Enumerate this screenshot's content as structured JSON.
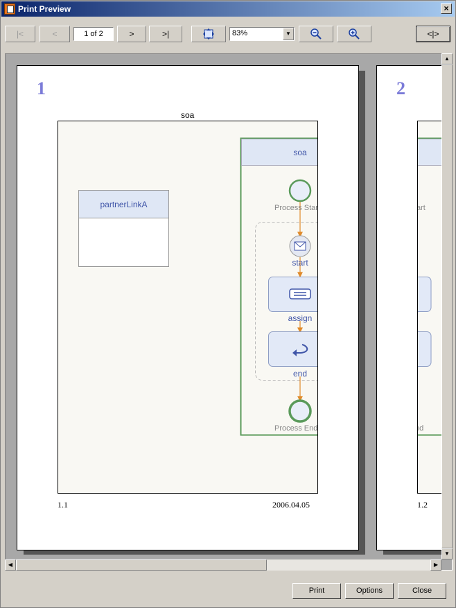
{
  "window": {
    "title": "Print Preview",
    "close_glyph": "×"
  },
  "toolbar": {
    "first_label": "|<",
    "prev_label": "<",
    "page_field": "1 of 2",
    "next_label": ">",
    "last_label": ">|",
    "zoom_value": "83%",
    "layout_label": "<|>"
  },
  "pages": [
    {
      "number": "1",
      "header": "soa",
      "footer_left": "1.1",
      "footer_right": "2006.04.05"
    },
    {
      "number": "2",
      "footer_left": "1.2"
    }
  ],
  "diagram": {
    "partner_link": "partnerLinkA",
    "process": "soa",
    "process_start": "Process Start",
    "process_end": "Process End",
    "activities": [
      "start",
      "assign",
      "end"
    ]
  },
  "buttons": {
    "print": "Print",
    "options": "Options",
    "close": "Close"
  },
  "colors": {
    "accent": "#7b7bd8",
    "scope_border": "#5a9a5a",
    "connector": "#e08a2a",
    "node_fill": "#dfe7f5"
  },
  "icons": [
    "app-icon",
    "fit-page-icon",
    "zoom-out-icon",
    "zoom-in-icon",
    "envelope-icon",
    "assign-icon",
    "end-arrow-icon"
  ]
}
